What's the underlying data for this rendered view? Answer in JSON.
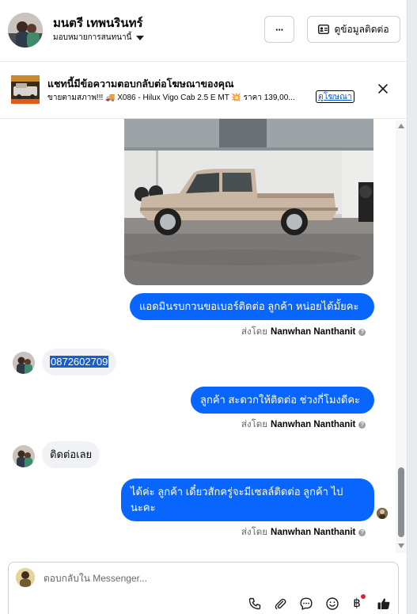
{
  "header": {
    "contact_name": "มนตรี เทพนรินทร์",
    "assign_label": "มอบหมายการสนทนานี้",
    "more_label": "···",
    "view_contact_label": "ดูข้อมูลติดต่อ"
  },
  "ad_banner": {
    "title": "แชทนี้มีข้อความตอบกลับต่อโฆษณาของคุณ",
    "description": "ขายตามสภาพ!!! 🚚 X086 - Hilux Vigo Cab 2.5 E MT 💥 ราคา 139,00...",
    "link_label": "ดูโฆษณา"
  },
  "messages": [
    {
      "type": "image",
      "sender": "page",
      "alt": "Hilux Vigo Cab pickup truck"
    },
    {
      "type": "text",
      "sender": "page",
      "text": "แอดมินรบกวนขอเบอร์ติดต่อ ลูกค้า หน่อยได้มั้ยคะ"
    },
    {
      "type": "text",
      "sender": "customer",
      "text": "0872602709"
    },
    {
      "type": "text",
      "sender": "page",
      "text": "ลูกค้า สะดวกให้ติดต่อ ช่วงกี่โมงดีคะ"
    },
    {
      "type": "text",
      "sender": "customer",
      "text": "ติดต่อเลย"
    },
    {
      "type": "text",
      "sender": "page",
      "line1": "ได้ค่ะ  ลูกค้า เดี๋ยวสักครู่จะมีเซลล์ติดต่อ ลูกค้า ไป",
      "line2": "นะคะ"
    }
  ],
  "sent_by": {
    "prefix": "ส่งโดย",
    "name": "Nanwhan Nanthanit"
  },
  "composer": {
    "placeholder": "ตอบกลับใน Messenger..."
  },
  "icons": {
    "more": "more-icon",
    "contact_card": "contact-card-icon",
    "close": "close-icon",
    "phone": "phone-icon",
    "attach": "paperclip-icon",
    "chat": "chat-bubble-icon",
    "emoji": "smiley-icon",
    "payment": "baht-icon",
    "like": "thumbs-up-icon"
  },
  "colors": {
    "outgoing_bubble": "#0866ff",
    "incoming_bubble": "#f0f2f5",
    "link": "#0a5bd6"
  }
}
